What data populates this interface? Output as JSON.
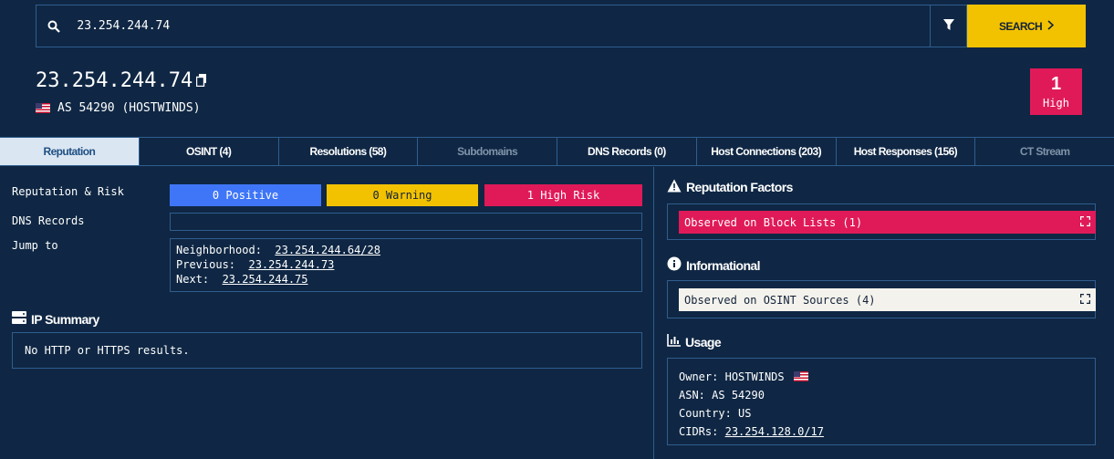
{
  "search": {
    "value": "23.254.244.74",
    "button_label": "SEARCH"
  },
  "header": {
    "ip": "23.254.244.74",
    "asn": "AS 54290 (HOSTWINDS)",
    "risk_count": "1",
    "risk_level": "High"
  },
  "tabs": [
    {
      "label": "Reputation"
    },
    {
      "label": "OSINT (4)"
    },
    {
      "label": "Resolutions (58)"
    },
    {
      "label": "Subdomains"
    },
    {
      "label": "DNS Records (0)"
    },
    {
      "label": "Host Connections (203)"
    },
    {
      "label": "Host Responses (156)"
    },
    {
      "label": "CT Stream"
    }
  ],
  "reputation": {
    "label": "Reputation & Risk",
    "positive": "0 Positive",
    "warning": "0 Warning",
    "high_risk": "1 High Risk",
    "dns_label": "DNS Records",
    "jump_label": "Jump to",
    "neighborhood_label": "Neighborhood:",
    "neighborhood": "23.254.244.64/28",
    "previous_label": "Previous:",
    "previous": "23.254.244.73",
    "next_label": "Next:",
    "next": "23.254.244.75"
  },
  "ip_summary": {
    "title": "IP Summary",
    "text": "No HTTP or HTTPS results."
  },
  "factors": {
    "title": "Reputation Factors",
    "item": "Observed on Block Lists (1)"
  },
  "informational": {
    "title": "Informational",
    "item": "Observed on OSINT Sources (4)"
  },
  "usage": {
    "title": "Usage",
    "owner_label": "Owner:",
    "owner": "HOSTWINDS",
    "asn_label": "ASN:",
    "asn": "AS 54290",
    "country_label": "Country:",
    "country": "US",
    "cidrs_label": "CIDRs:",
    "cidrs": "23.254.128.0/17"
  },
  "colors": {
    "background": "#0f2744",
    "accent_yellow": "#f2c200",
    "risk_red": "#e01a59",
    "positive_blue": "#3f76f8",
    "border": "#2f5d8f"
  }
}
